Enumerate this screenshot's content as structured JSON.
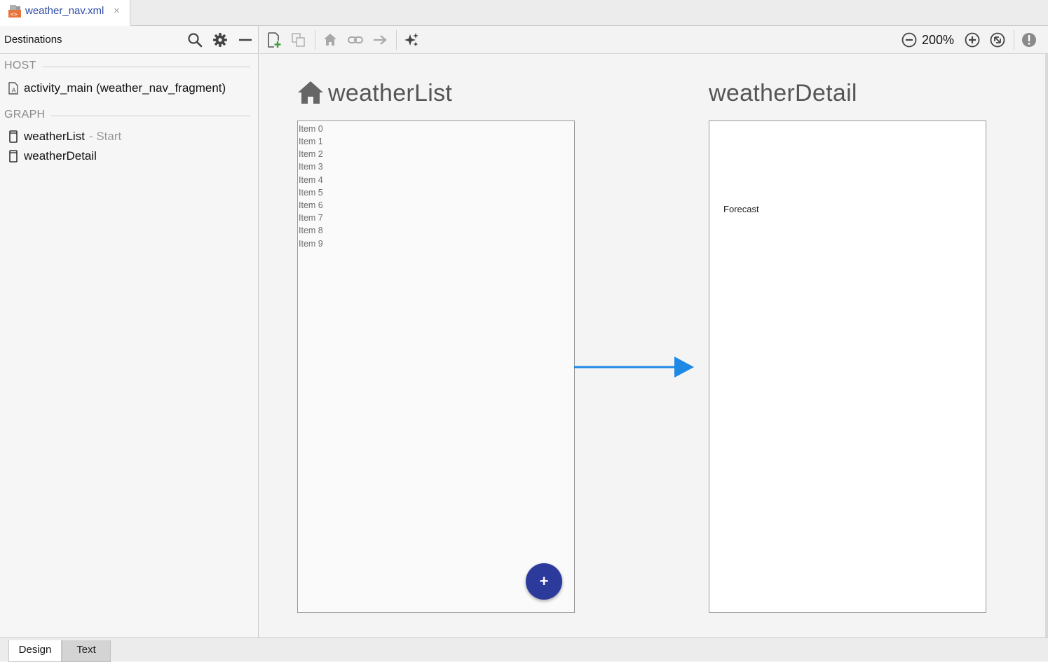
{
  "file_tab": {
    "name": "weather_nav.xml",
    "close": "×"
  },
  "left_panel": {
    "title": "Destinations",
    "host_label": "HOST",
    "host_item": "activity_main (weather_nav_fragment)",
    "graph_label": "GRAPH",
    "graph_items": [
      {
        "label": "weatherList",
        "suffix": "- Start"
      },
      {
        "label": "weatherDetail",
        "suffix": ""
      }
    ]
  },
  "toolbar": {
    "zoom": "200%",
    "icons": [
      "new-destination-icon",
      "nested-graph-icon",
      "start-destination-icon",
      "deep-link-icon",
      "action-icon",
      "auto-arrange-icon",
      "zoom-out-icon",
      "zoom-in-icon",
      "zoom-to-fit-icon",
      "warning-icon"
    ]
  },
  "canvas": {
    "destinations": [
      {
        "title": "weatherList",
        "items": [
          "Item 0",
          "Item 1",
          "Item 2",
          "Item 3",
          "Item 4",
          "Item 5",
          "Item 6",
          "Item 7",
          "Item 8",
          "Item 9"
        ],
        "fab": "+"
      },
      {
        "title": "weatherDetail",
        "content": "Forecast"
      }
    ],
    "action_color": "#1e88e5"
  },
  "bottom_tabs": [
    "Design",
    "Text"
  ]
}
